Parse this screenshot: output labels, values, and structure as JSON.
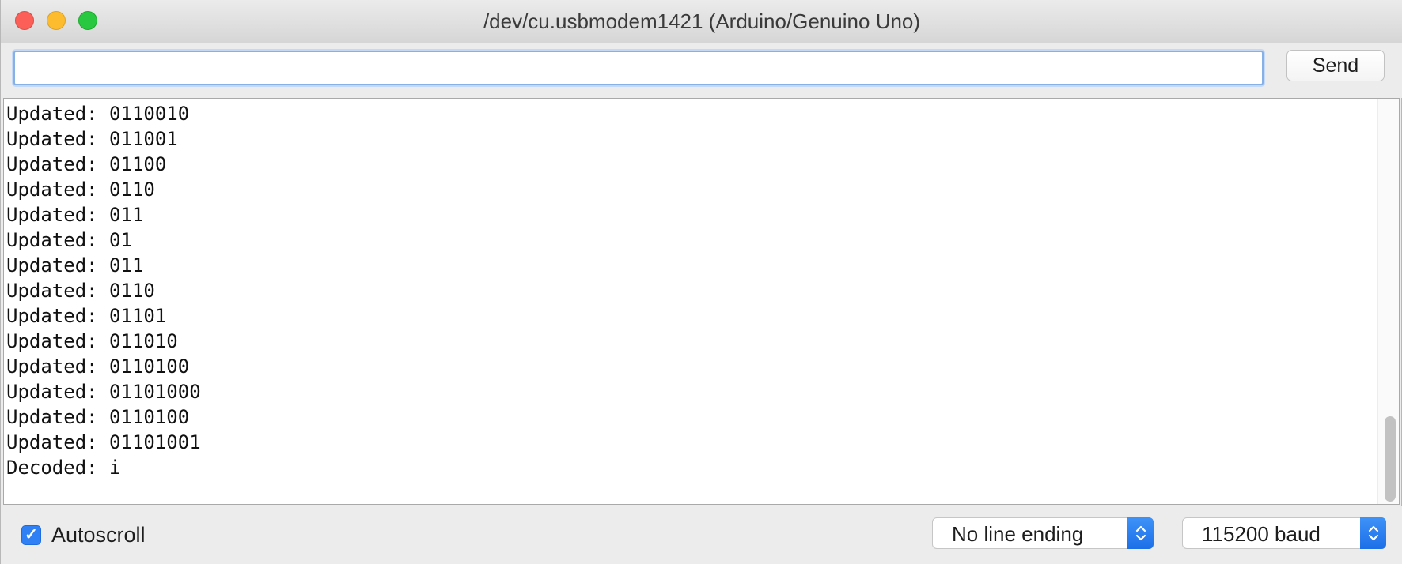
{
  "window": {
    "title": "/dev/cu.usbmodem1421 (Arduino/Genuino Uno)"
  },
  "input": {
    "value": "",
    "placeholder": "",
    "send_label": "Send"
  },
  "output": {
    "lines": [
      "Updated: 0110010",
      "Updated: 011001",
      "Updated: 01100",
      "Updated: 0110",
      "Updated: 011",
      "Updated: 01",
      "Updated: 011",
      "Updated: 0110",
      "Updated: 01101",
      "Updated: 011010",
      "Updated: 0110100",
      "Updated: 01101000",
      "Updated: 0110100",
      "Updated: 01101001",
      "Decoded: i"
    ]
  },
  "footer": {
    "autoscroll_label": "Autoscroll",
    "autoscroll_checked": true,
    "line_ending": "No line ending",
    "baud_rate": "115200 baud"
  },
  "colors": {
    "accent": "#2f7ff5",
    "close": "#fc5f57",
    "minimize": "#fdbc2e",
    "zoom": "#28c840"
  },
  "icons": {
    "checkmark": "check-icon",
    "select_arrows": "chevron-updown-icon"
  }
}
